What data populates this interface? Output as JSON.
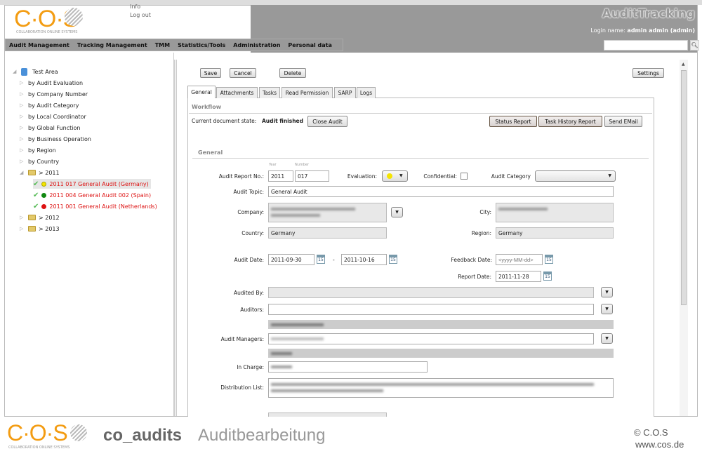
{
  "header": {
    "brand": "C·O·S",
    "brand_tagline": "COLLABORATION ONLINE SYSTEMS",
    "links": [
      "Info",
      "Log out"
    ],
    "app_title": "AuditTracking",
    "login_label": "Login name:",
    "login_user": "admin admin (admin)",
    "search_placeholder": ""
  },
  "menu": [
    "Audit Management",
    "Tracking Management",
    "TMM",
    "Statistics/Tools",
    "Administration",
    "Personal data"
  ],
  "tree": {
    "root": "Test Area",
    "groups": [
      "by Audit Evaluation",
      "by Company Number",
      "by Audit Category",
      "by Local Coordinator",
      "by Global Function",
      "by Business Operation",
      "by Region",
      "by Country"
    ],
    "years": [
      {
        "label": "> 2011",
        "expanded": true,
        "items": [
          {
            "label": "2011 017 General Audit (Germany)",
            "status": "#f5e400",
            "selected": true
          },
          {
            "label": "2011 004 General Audit 002 (Spain)",
            "status": "#118811"
          },
          {
            "label": "2011 001 General Audit (Netherlands)",
            "status": "#dd1111"
          }
        ]
      },
      {
        "label": "> 2012"
      },
      {
        "label": "> 2013"
      }
    ]
  },
  "toolbar": {
    "save": "Save",
    "cancel": "Cancel",
    "delete": "Delete",
    "settings": "Settings"
  },
  "tabs": [
    {
      "label": "General",
      "active": true
    },
    {
      "label": "Attachments"
    },
    {
      "label": "Tasks"
    },
    {
      "label": "Read Permission"
    },
    {
      "label": "SARP"
    },
    {
      "label": "Logs"
    }
  ],
  "workflow": {
    "title": "Workflow",
    "state_label": "Current document state:",
    "state_value": "Audit finished",
    "close_audit": "Close Audit",
    "status_report": "Status Report",
    "task_history_report": "Task History Report",
    "send_email": "Send EMail"
  },
  "general": {
    "title": "General",
    "year_hint": "Year",
    "number_hint": "Number",
    "report_no_label": "Audit Report No.:",
    "year": "2011",
    "number": "017",
    "evaluation_label": "Evaluation:",
    "evaluation_color": "#f5e400",
    "confidential_label": "Confidential:",
    "confidential": false,
    "category_label": "Audit Category",
    "category": "",
    "topic_label": "Audit Topic:",
    "topic": "General Audit",
    "company_label": "Company:",
    "city_label": "City:",
    "country_label": "Country:",
    "country": "Germany",
    "region_label": "Region:",
    "region": "Germany",
    "audit_date_label": "Audit Date:",
    "audit_date_from": "2011-09-30",
    "date_sep": "-",
    "audit_date_to": "2011-10-16",
    "feedback_date_label": "Feedback Date:",
    "feedback_placeholder": "<yyyy-MM-dd>",
    "report_date_label": "Report Date:",
    "report_date": "2011-11-28",
    "audited_by_label": "Audited By:",
    "auditors_label": "Auditors:",
    "audit_managers_label": "Audit Managers:",
    "in_charge_label": "In Charge:",
    "distribution_label": "Distribution List:",
    "calendar_day": "15"
  },
  "footer": {
    "product": "co_audits",
    "subtitle": "Auditbearbeitung",
    "copyright": "© C.O.S",
    "url": "www.cos.de"
  }
}
